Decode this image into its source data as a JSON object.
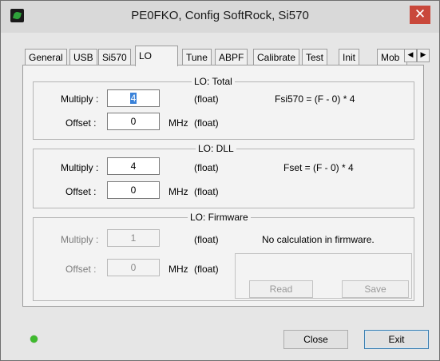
{
  "window": {
    "title": "PE0FKO, Config SoftRock, Si570",
    "close_glyph": "✕"
  },
  "tabs": [
    "General",
    "USB",
    "Si570",
    "LO",
    "Tune",
    "ABPF",
    "Calibrate",
    "Test",
    "Init",
    "Mob"
  ],
  "active_tab": "LO",
  "tab_scroll": {
    "left": "◀",
    "right": "▶"
  },
  "groups": {
    "total": {
      "title": "LO: Total",
      "multiply_label": "Multiply :",
      "multiply_value": "4",
      "offset_label": "Offset :",
      "offset_value": "0",
      "multiply_unit": "(float)",
      "offset_unit_mhz": "MHz",
      "offset_unit_float": "(float)",
      "formula": "Fsi570 = (F - 0) * 4"
    },
    "dll": {
      "title": "LO: DLL",
      "multiply_label": "Multiply :",
      "multiply_value": "4",
      "offset_label": "Offset :",
      "offset_value": "0",
      "multiply_unit": "(float)",
      "offset_unit_mhz": "MHz",
      "offset_unit_float": "(float)",
      "formula": "Fset = (F - 0) * 4"
    },
    "firmware": {
      "title": "LO: Firmware",
      "multiply_label": "Multiply :",
      "multiply_value": "1",
      "offset_label": "Offset :",
      "offset_value": "0",
      "multiply_unit": "(float)",
      "offset_unit_mhz": "MHz",
      "offset_unit_float": "(float)",
      "formula": "No calculation in firmware.",
      "read_label": "Read",
      "save_label": "Save"
    }
  },
  "footer": {
    "close_label": "Close",
    "exit_label": "Exit",
    "status_color": "#3fba2e"
  }
}
